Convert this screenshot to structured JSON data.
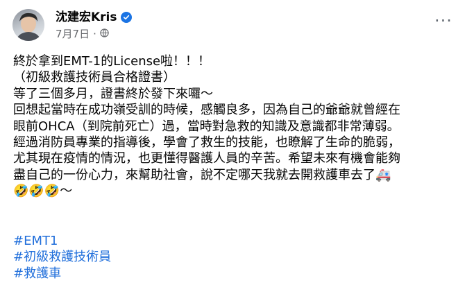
{
  "post": {
    "author": "沈建宏Kris",
    "date": "7月7日",
    "more_label": "···",
    "lines": [
      "終於拿到EMT-1的License啦！！！",
      "（初級救護技術員合格證書）",
      "等了三個多月，證書終於發下來囉～",
      "回想起當時在成功嶺受訓的時候，感觸良多，因為自己的爺爺就曾經在",
      "眼前OHCA（到院前死亡）過，當時對急救的知識及意識都非常薄弱。",
      "經過消防員專業的指導後，學會了救生的技能，也瞭解了生命的脆弱，",
      "尤其現在疫情的情況，也更懂得醫護人員的辛苦。希望未來有機會能夠",
      "盡自己的一份心力，來幫助社會，說不定哪天我就去開救護車去了🚑",
      "🤣🤣🤣～"
    ],
    "hashtags": [
      "#EMT1",
      "#初級救護技術員",
      "#救護車"
    ]
  }
}
